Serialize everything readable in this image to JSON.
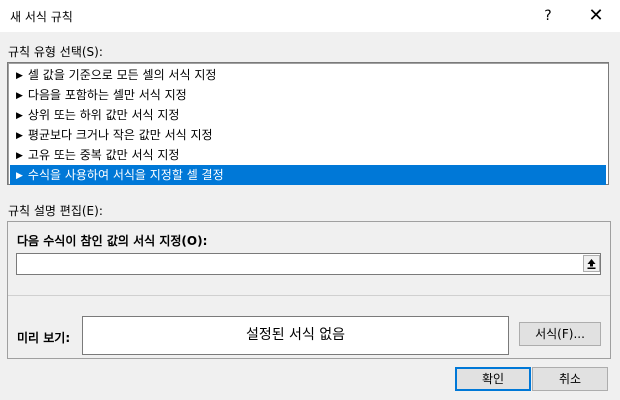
{
  "window": {
    "title": "새 서식 규칙",
    "help": "?",
    "close": "✕"
  },
  "rule_type": {
    "label": "규칙 유형 선택(S):",
    "items": [
      {
        "label": "셀 값을 기준으로 모든 셀의 서식 지정",
        "selected": false
      },
      {
        "label": "다음을 포함하는 셀만 서식 지정",
        "selected": false
      },
      {
        "label": "상위 또는 하위 값만 서식 지정",
        "selected": false
      },
      {
        "label": "평균보다 크거나 작은 값만 서식 지정",
        "selected": false
      },
      {
        "label": "고유 또는 중복 값만 서식 지정",
        "selected": false
      },
      {
        "label": "수식을 사용하여 서식을 지정할 셀 결정",
        "selected": true
      }
    ],
    "arrow": "▶"
  },
  "rule_desc": {
    "label": "규칙 설명 편집(E):",
    "formula_label": "다음 수식이 참인 값의 서식 지정(O):",
    "formula_value": "",
    "collapse_icon": "collapse-dialog-icon"
  },
  "preview": {
    "label": "미리 보기:",
    "text": "설정된 서식 없음",
    "format_button": "서식(F)..."
  },
  "buttons": {
    "ok": "확인",
    "cancel": "취소"
  }
}
